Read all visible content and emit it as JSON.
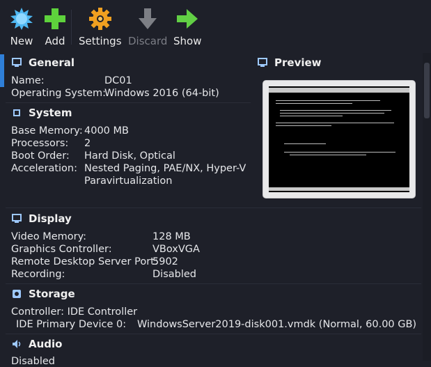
{
  "toolbar": {
    "new_label": "New",
    "add_label": "Add",
    "settings_label": "Settings",
    "discard_label": "Discard",
    "show_label": "Show"
  },
  "general": {
    "title": "General",
    "name_label": "Name:",
    "name_value": "DC01",
    "os_label": "Operating System:",
    "os_value": "Windows 2016 (64-bit)"
  },
  "system": {
    "title": "System",
    "memory_label": "Base Memory:",
    "memory_value": "4000 MB",
    "processors_label": "Processors:",
    "processors_value": "2",
    "boot_label": "Boot Order:",
    "boot_value": "Hard Disk, Optical",
    "accel_label": "Acceleration:",
    "accel_value_line1": "Nested Paging, PAE/NX, Hyper-V",
    "accel_value_line2": "Paravirtualization"
  },
  "preview": {
    "title": "Preview"
  },
  "display": {
    "title": "Display",
    "video_label": "Video Memory:",
    "video_value": "128 MB",
    "gfx_label": "Graphics Controller:",
    "gfx_value": "VBoxVGA",
    "rdp_label": "Remote Desktop Server Port:",
    "rdp_value": "5902",
    "rec_label": "Recording:",
    "rec_value": "Disabled"
  },
  "storage": {
    "title": "Storage",
    "controller_line": "Controller: IDE Controller",
    "device_label": "IDE Primary Device 0:",
    "device_value": "WindowsServer2019-disk001.vmdk (Normal, 60.00 GB)"
  },
  "audio": {
    "title": "Audio",
    "partial_line": "Disabled"
  },
  "colors": {
    "background": "#1e2029",
    "accent": "#2f7fd8"
  }
}
